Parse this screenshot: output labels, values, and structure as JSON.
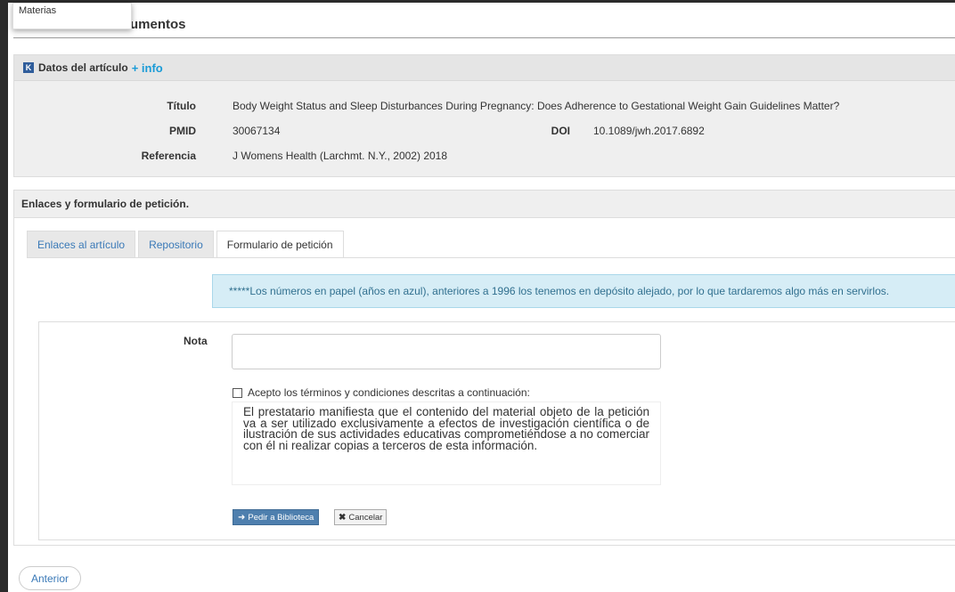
{
  "dropdown": {
    "item": "Materias"
  },
  "page": {
    "heading": "umentos"
  },
  "article": {
    "panel_title": "Datos del artículo",
    "more_link": "+ info",
    "titulo_label": "Título",
    "titulo": "Body Weight Status and Sleep Disturbances During Pregnancy: Does Adherence to Gestational Weight Gain Guidelines Matter?",
    "pmid_label": "PMID",
    "pmid": "30067134",
    "doi_label": "DOI",
    "doi": "10.1089/jwh.2017.6892",
    "referencia_label": "Referencia",
    "referencia": "J Womens Health (Larchmt. N.Y., 2002) 2018"
  },
  "links": {
    "panel_title": "Enlaces y formulario de petición.",
    "tabs": [
      {
        "label": "Enlaces al artículo"
      },
      {
        "label": "Repositorio"
      },
      {
        "label": "Formulario de petición"
      }
    ],
    "alert": "*****Los números en papel (años en azul), anteriores a 1996 los tenemos en depósito alejado, por lo que tardaremos algo más en servirlos."
  },
  "form": {
    "nota_label": "Nota",
    "nota_value": "",
    "accept_label": "Acepto los términos y condiciones descritas a continuación:",
    "terms": "El prestatario manifiesta que el contenido del material objeto de la petición va a ser utilizado exclusivamente a efectos de investigación científica o de ilustración de sus actividades educativas comprometiéndose a no comerciar con él ni realizar copias a terceros de esta información.",
    "submit": "Pedir a Biblioteca",
    "cancel": "Cancelar"
  },
  "nav": {
    "previous": "Anterior"
  },
  "colors": {
    "accent": "#1a9bd7",
    "button_primary": "#4e7fae",
    "alert_bg": "#d6edf6"
  }
}
